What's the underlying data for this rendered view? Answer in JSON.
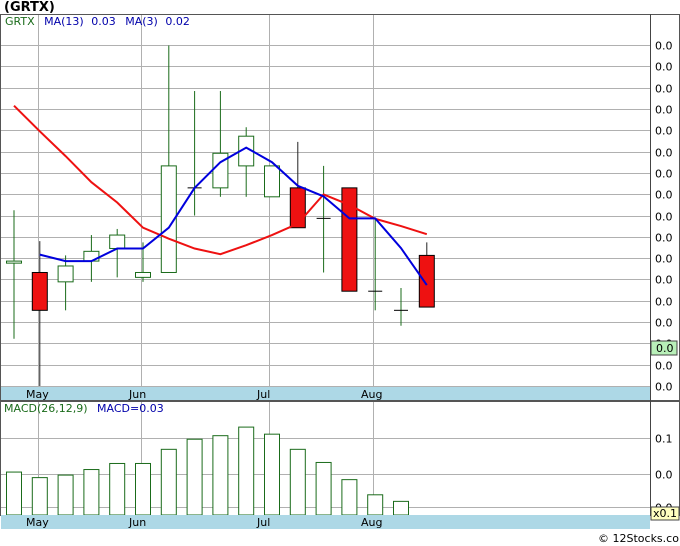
{
  "title": "(GRTX)",
  "credit": "© 12Stocks.com",
  "colors": {
    "up_candle": "#1a6b1a",
    "down_candle": "#ee1111",
    "ma13": "#ee1111",
    "ma3": "#0000dd",
    "macd_bar": "#1a6b1a",
    "axis_band": "#add8e6",
    "grid": "#b0b0b0",
    "last_badge": "#b8f0b8"
  },
  "chart_data": [
    {
      "type": "candlestick",
      "legend": {
        "symbol": "GRTX",
        "ma13_label": "MA(13)",
        "ma13_value": "0.03",
        "ma3_label": "MA(3)",
        "ma3_value": "0.02"
      },
      "y_tick_labels": [
        "0.0",
        "0.0",
        "0.0",
        "0.0",
        "0.0",
        "0.0",
        "0.0",
        "0.0",
        "0.0",
        "0.0",
        "0.0",
        "0.0",
        "0.0",
        "0.0",
        "0.0",
        "0.0",
        "0.0"
      ],
      "last_value_label": "0.0",
      "x_tick_labels": [
        "May",
        "Jun",
        "Jul",
        "Aug"
      ],
      "ylim": [
        0.0,
        0.0875
      ],
      "candles": [
        {
          "o": 0.0302,
          "h": 0.0432,
          "l": 0.0116,
          "c": 0.0307
        },
        {
          "o": 0.0279,
          "h": 0.0356,
          "l": 0.0,
          "c": 0.0186
        },
        {
          "o": 0.0256,
          "h": 0.0321,
          "l": 0.0186,
          "c": 0.0295
        },
        {
          "o": 0.0307,
          "h": 0.0371,
          "l": 0.0256,
          "c": 0.0331
        },
        {
          "o": 0.0338,
          "h": 0.0386,
          "l": 0.0267,
          "c": 0.0371
        },
        {
          "o": 0.0267,
          "h": 0.0353,
          "l": 0.0256,
          "c": 0.0279
        },
        {
          "o": 0.0279,
          "h": 0.0837,
          "l": 0.0279,
          "c": 0.0541
        },
        {
          "o": 0.0487,
          "h": 0.0725,
          "l": 0.0419,
          "c": 0.0487
        },
        {
          "o": 0.0487,
          "h": 0.0725,
          "l": 0.0465,
          "c": 0.0572
        },
        {
          "o": 0.0541,
          "h": 0.0636,
          "l": 0.0465,
          "c": 0.0614
        },
        {
          "o": 0.0465,
          "h": 0.0541,
          "l": 0.0465,
          "c": 0.0541
        },
        {
          "o": 0.0487,
          "h": 0.06,
          "l": 0.0412,
          "c": 0.0389
        },
        {
          "o": 0.0412,
          "h": 0.0541,
          "l": 0.0279,
          "c": 0.0412
        },
        {
          "o": 0.0487,
          "h": 0.0487,
          "l": 0.0233,
          "c": 0.0233
        },
        {
          "o": 0.0233,
          "h": 0.0412,
          "l": 0.0186,
          "c": 0.0233
        },
        {
          "o": 0.0186,
          "h": 0.0241,
          "l": 0.0148,
          "c": 0.0186
        },
        {
          "o": 0.0321,
          "h": 0.0353,
          "l": 0.0194,
          "c": 0.0194
        }
      ],
      "ma13": [
        null,
        null,
        null,
        null,
        null,
        null,
        null,
        null,
        null,
        null,
        null,
        null,
        null,
        null,
        null,
        null,
        null
      ],
      "ma13_points": [
        [
          0,
          0.0689
        ],
        [
          1,
          0.0626
        ],
        [
          2,
          0.0565
        ],
        [
          3,
          0.0501
        ],
        [
          4,
          0.0451
        ],
        [
          5,
          0.0389
        ],
        [
          6,
          0.0362
        ],
        [
          7,
          0.0338
        ],
        [
          8,
          0.0324
        ],
        [
          9,
          0.0346
        ],
        [
          10,
          0.0371
        ],
        [
          11,
          0.0399
        ],
        [
          12,
          0.0471
        ],
        [
          13,
          0.0445
        ],
        [
          14,
          0.0411
        ],
        [
          15,
          0.0393
        ],
        [
          16,
          0.0373
        ]
      ],
      "ma3_points": [
        [
          1,
          0.0323
        ],
        [
          2,
          0.0307
        ],
        [
          3,
          0.0307
        ],
        [
          4,
          0.0338
        ],
        [
          5,
          0.0338
        ],
        [
          6,
          0.0389
        ],
        [
          7,
          0.0487
        ],
        [
          8,
          0.055
        ],
        [
          9,
          0.0586
        ],
        [
          10,
          0.055
        ],
        [
          11,
          0.0492
        ],
        [
          12,
          0.0466
        ],
        [
          13,
          0.0412
        ],
        [
          14,
          0.0412
        ],
        [
          15,
          0.0339
        ],
        [
          16,
          0.0248
        ]
      ]
    },
    {
      "type": "bar",
      "legend": {
        "label": "MACD(26,12,9)",
        "value_label": "MACD=0.03"
      },
      "y_tick_labels": [
        "0.1",
        "0.0",
        "0.0"
      ],
      "last_value_label": "x0.1",
      "x_tick_labels": [
        "May",
        "Jun",
        "Jul",
        "Aug"
      ],
      "ylim": [
        -0.02,
        0.17
      ],
      "values": [
        0.063,
        0.052,
        0.057,
        0.068,
        0.08,
        0.08,
        0.108,
        0.128,
        0.135,
        0.152,
        0.138,
        0.108,
        0.082,
        0.048,
        0.018,
        0.005
      ]
    }
  ]
}
